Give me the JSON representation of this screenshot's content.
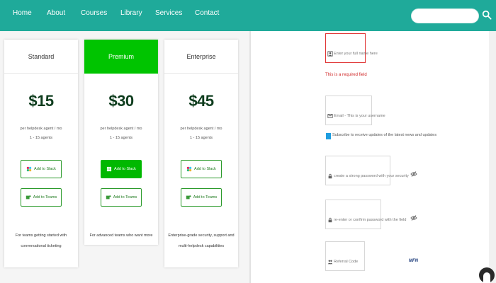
{
  "nav": {
    "links": [
      "Home",
      "About",
      "Courses",
      "Library",
      "Services",
      "Contact"
    ],
    "search_placeholder": ""
  },
  "pricing": {
    "plans": [
      {
        "name": "Standard",
        "price": "$15",
        "desc1": "per helpdesk agent / mo",
        "desc2": "1 - 15 agents",
        "slack_label": "Add to Slack",
        "teams_label": "Add to Teams",
        "footnote1": "For teams getting started with",
        "footnote2": "conversational ticketing"
      },
      {
        "name": "Premium",
        "price": "$30",
        "desc1": "per helpdesk agent / mo",
        "desc2": "1 - 15 agents",
        "slack_label": "Add to Slack",
        "teams_label": "Add to Teams",
        "footnote1": "For advanced teams who want more",
        "footnote2": ""
      },
      {
        "name": "Enterprise",
        "price": "$45",
        "desc1": "per helpdesk agent / mo",
        "desc2": "1 - 15 agents",
        "slack_label": "Add to Slack",
        "teams_label": "Add to Teams",
        "footnote1": "Enterprise-grade security, support and",
        "footnote2": "multi-helpdesk capabilities"
      }
    ]
  },
  "form": {
    "name_placeholder": "Enter your full name here",
    "name_error": "This is a required field",
    "email_placeholder": "Email - This is your username",
    "updates_label": "Subscribe to receive updates of the latest news and updates",
    "password_placeholder": "create a strong password with your security",
    "confirm_placeholder": "re-enter or confirm password with the field",
    "referral_placeholder": "Referral Code",
    "captcha_text": "MFN"
  },
  "colors": {
    "nav": "#1faa9a",
    "premium": "#00c400",
    "error": "#e03434",
    "button_green": "#00b800"
  }
}
